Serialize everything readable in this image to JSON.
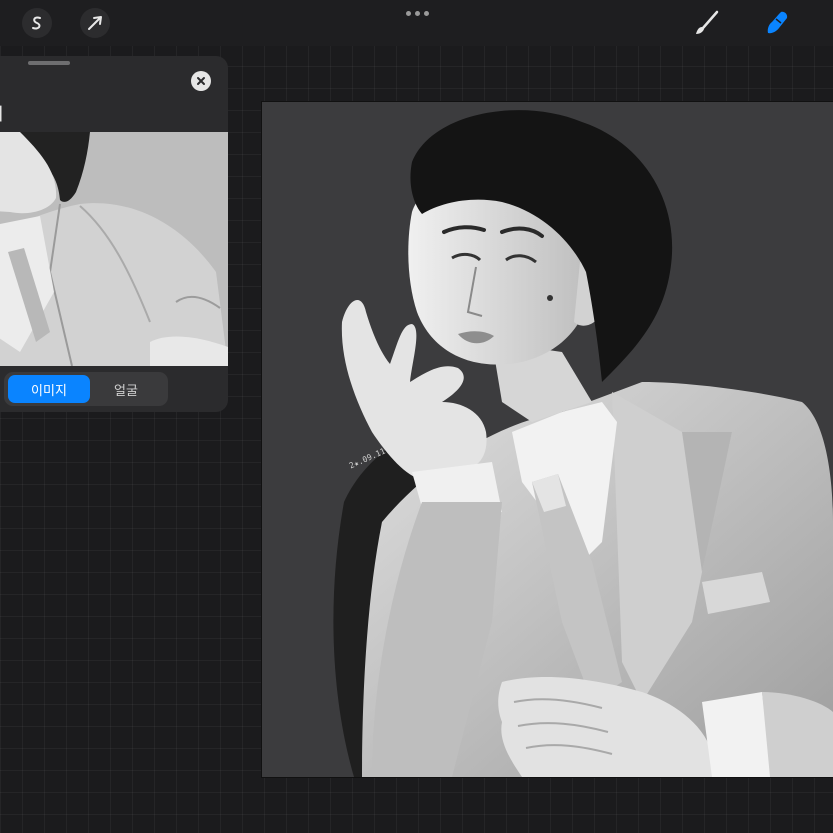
{
  "toolbar": {
    "icons": [
      "smudge-s-icon",
      "arrow-transform-icon",
      "more-dots-icon",
      "brush-icon",
      "smudge-finger-icon"
    ],
    "accent": "#0a84ff"
  },
  "reference": {
    "title": "기",
    "tabs": [
      {
        "label": "이미지",
        "active": true
      },
      {
        "label": "얼굴",
        "active": false
      }
    ]
  },
  "artwork": {
    "signature": "2★.09.11"
  }
}
